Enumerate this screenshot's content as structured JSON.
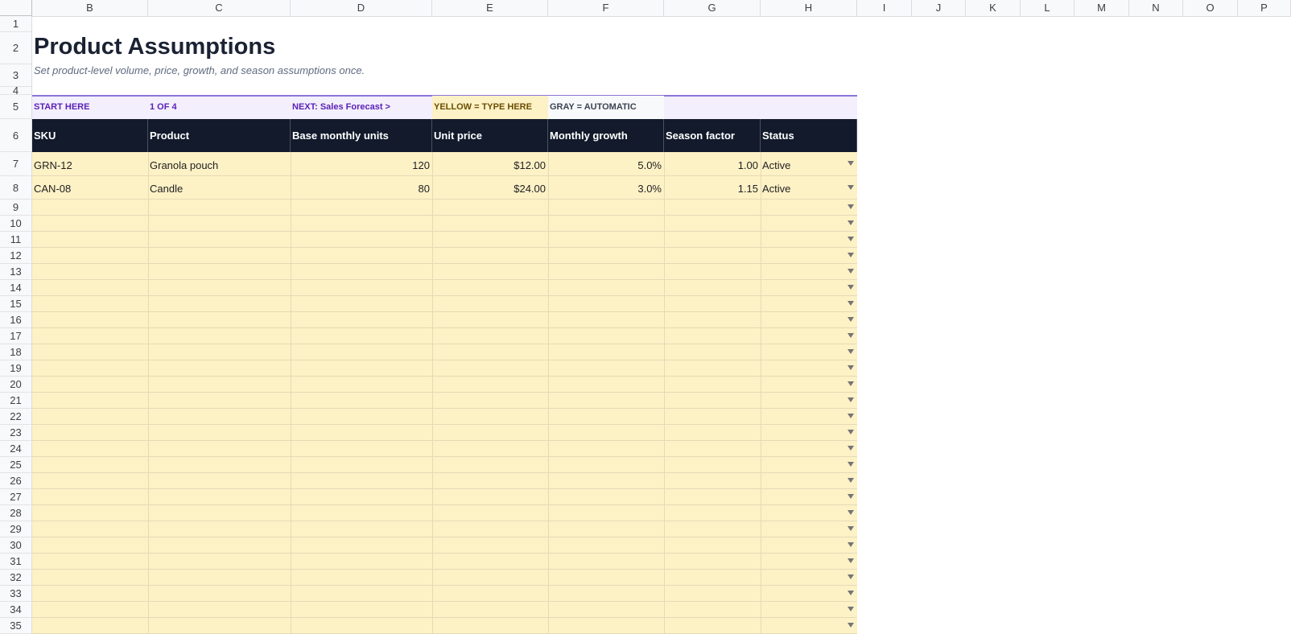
{
  "sheet": {
    "columns": [
      "B",
      "C",
      "D",
      "E",
      "F",
      "G",
      "H",
      "I",
      "J",
      "K",
      "L",
      "M",
      "N",
      "O",
      "P"
    ],
    "row_numbers": [
      "1",
      "2",
      "3",
      "4",
      "5",
      "6",
      "7",
      "8",
      "9",
      "10",
      "11",
      "12",
      "13",
      "14",
      "15",
      "16",
      "17",
      "18",
      "19",
      "20",
      "21",
      "22",
      "23",
      "24",
      "25",
      "26",
      "27",
      "28",
      "29",
      "30",
      "31",
      "32",
      "33",
      "34",
      "35"
    ]
  },
  "title": "Product Assumptions",
  "subtitle": "Set product-level volume, price, growth, and season assumptions once.",
  "banner": {
    "start": "START HERE",
    "step": "1 OF 4",
    "next": "NEXT: Sales Forecast  >",
    "yellow_legend": "YELLOW = TYPE HERE",
    "gray_legend": "GRAY = AUTOMATIC"
  },
  "table": {
    "headers": [
      "SKU",
      "Product",
      "Base monthly units",
      "Unit price",
      "Monthly growth",
      "Season factor",
      "Status"
    ],
    "rows": [
      {
        "sku": "GRN-12",
        "product": "Granola pouch",
        "units": "120",
        "price": "$12.00",
        "growth": "5.0%",
        "season": "1.00",
        "status": "Active"
      },
      {
        "sku": "CAN-08",
        "product": "Candle",
        "units": "80",
        "price": "$24.00",
        "growth": "3.0%",
        "season": "1.15",
        "status": "Active"
      }
    ]
  },
  "colors": {
    "header_bg": "#121a2b",
    "input_yellow": "#fdf1c6",
    "banner_bg": "#f3effd",
    "banner_accent": "#8b76d8",
    "banner_text": "#5b21b6"
  }
}
